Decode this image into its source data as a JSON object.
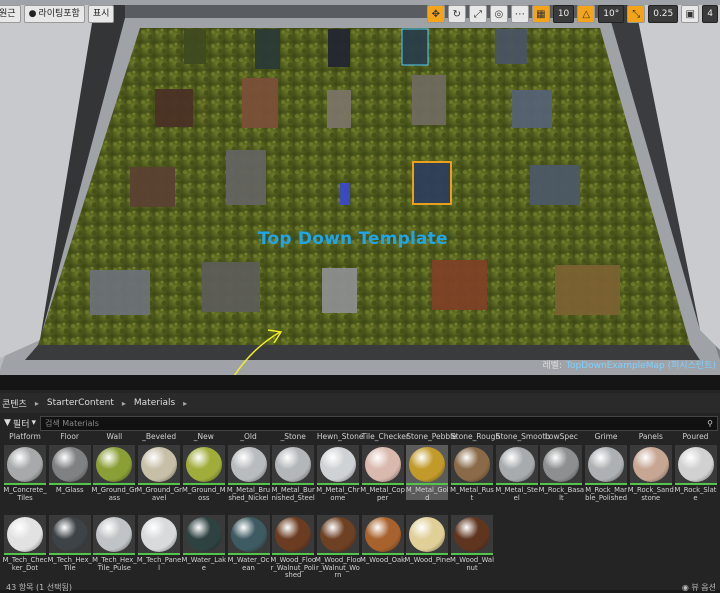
{
  "viewport": {
    "toolbar_left": [
      {
        "label": "원근",
        "icon": "perspective-icon"
      },
      {
        "label": "라이팅포함",
        "icon": "lit-icon"
      },
      {
        "label": "표시",
        "icon": "show-icon"
      }
    ],
    "toolbar_right": {
      "grid_snap_value": "10",
      "rotation_snap_value": "10°",
      "scale_snap_value": "0.25",
      "camera_speed": "4"
    },
    "overlay_title": "Top Down Template",
    "level_label_key": "레벨:",
    "level_label_value": "TopDownExampleMap (퍼시스턴트)"
  },
  "content_browser": {
    "breadcrumb": [
      "콘텐츠",
      "StarterContent",
      "Materials"
    ],
    "filter_label": "필터",
    "search_placeholder": "검색 Materials",
    "row1_headers": [
      "Platform",
      "Floor",
      "Wall",
      "_Beveled",
      "_New",
      "_Old",
      "_Stone",
      "Hewn_Stone",
      "Tile_Checker",
      "Stone_Pebble",
      "Stone_Rough",
      "Stone_Smooth",
      "LowSpec",
      "Grime",
      "Panels",
      "Poured"
    ],
    "row1": [
      {
        "label": "M_Concrete_Tiles",
        "color": "#a7a9aa"
      },
      {
        "label": "M_Glass",
        "color": "#7f8183"
      },
      {
        "label": "M_Ground_Grass",
        "color": "#8aa036"
      },
      {
        "label": "M_Ground_Gravel",
        "color": "#c8bfa8"
      },
      {
        "label": "M_Ground_Moss",
        "color": "#a1ad3a"
      },
      {
        "label": "M_Metal_Brushed_Nickel",
        "color": "#b9bcbf"
      },
      {
        "label": "M_Metal_Burnished_Steel",
        "color": "#b4b7ba"
      },
      {
        "label": "M_Metal_Chrome",
        "color": "#cfd2d5"
      },
      {
        "label": "M_Metal_Copper",
        "color": "#d9b8ad"
      },
      {
        "label": "M_Metal_Gold",
        "color": "#c29a2a"
      },
      {
        "label": "M_Metal_Rust",
        "color": "#8a6a48"
      },
      {
        "label": "M_Metal_Steel",
        "color": "#a7abae"
      },
      {
        "label": "M_Rock_Basalt",
        "color": "#8d8f90"
      },
      {
        "label": "M_Rock_Marble_Polished",
        "color": "#aeb1b3"
      },
      {
        "label": "M_Rock_Sandstone",
        "color": "#c7a694"
      },
      {
        "label": "M_Rock_Slate",
        "color": "#d1d1d1"
      }
    ],
    "row2": [
      {
        "label": "M_Tech_Checker_Dot",
        "color": "#e2e2e2"
      },
      {
        "label": "M_Tech_Hex_Tile",
        "color": "#3e4347"
      },
      {
        "label": "M_Tech_Hex_Tile_Pulse",
        "color": "#c0c4c6"
      },
      {
        "label": "M_Tech_Panel",
        "color": "#d8dadc"
      },
      {
        "label": "M_Water_Lake",
        "color": "#2f4242"
      },
      {
        "label": "M_Water_Ocean",
        "color": "#3e5a62"
      },
      {
        "label": "M_Wood_Floor_Walnut_Polished",
        "color": "#6b3c22"
      },
      {
        "label": "M_Wood_Floor_Walnut_Worn",
        "color": "#6e4024"
      },
      {
        "label": "M_Wood_Oak",
        "color": "#a8622d"
      },
      {
        "label": "M_Wood_Pine",
        "color": "#e0cf97"
      },
      {
        "label": "M_Wood_Walnut",
        "color": "#603520"
      }
    ],
    "status_text": "43 항목 (1 선택됨)",
    "view_options_label": "뷰 옵션"
  }
}
